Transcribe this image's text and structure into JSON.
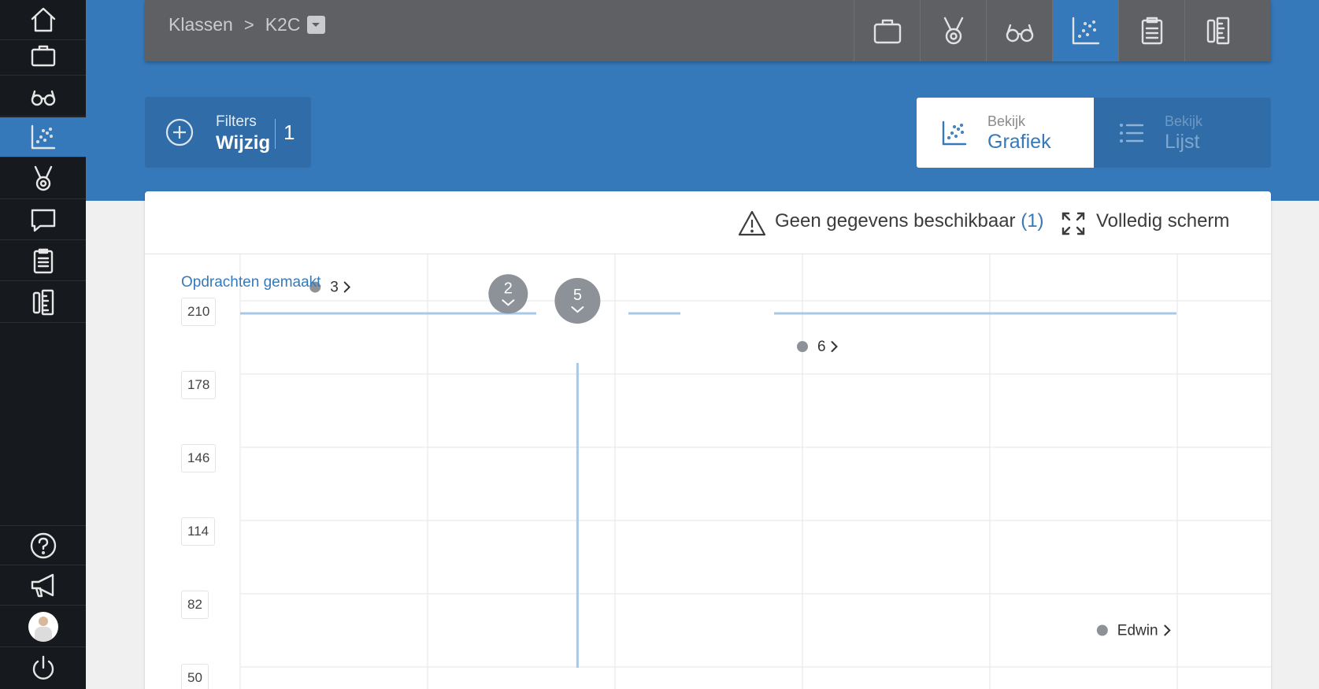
{
  "sidebar": {
    "top_items": [
      {
        "icon": "home-icon"
      },
      {
        "icon": "briefcase-icon"
      },
      {
        "icon": "glasses-icon"
      },
      {
        "icon": "scatter-chart-icon",
        "active": true
      },
      {
        "icon": "medal-icon"
      },
      {
        "icon": "chat-icon"
      },
      {
        "icon": "clipboard-icon"
      },
      {
        "icon": "tools-icon"
      }
    ],
    "bottom_items": [
      {
        "icon": "help-icon"
      },
      {
        "icon": "megaphone-icon"
      },
      {
        "icon": "avatar"
      },
      {
        "icon": "power-icon"
      }
    ]
  },
  "topbar": {
    "breadcrumb": {
      "root": "Klassen",
      "separator": ">",
      "current": "K2C"
    },
    "tools": [
      {
        "icon": "briefcase-icon"
      },
      {
        "icon": "medal-icon"
      },
      {
        "icon": "glasses-icon"
      },
      {
        "icon": "scatter-chart-icon",
        "active": true
      },
      {
        "icon": "clipboard-icon"
      },
      {
        "icon": "tools-icon"
      }
    ]
  },
  "filters": {
    "label": "Filters",
    "action": "Wijzig",
    "count": "1"
  },
  "view_toggle": {
    "grafiek": {
      "small": "Bekijk",
      "big": "Grafiek",
      "active": true
    },
    "lijst": {
      "small": "Bekijk",
      "big": "Lijst",
      "active": false
    }
  },
  "card_header": {
    "warning_text": "Geen gegevens beschikbaar",
    "warning_count": "(1)",
    "fullscreen_label": "Volledig scherm"
  },
  "colors": {
    "accent": "#3579ba",
    "sidebar_bg": "#16191d",
    "topbar_bg": "#5e6064",
    "cluster": "#8d9299",
    "line": "#a9c8e6"
  },
  "chart_data": {
    "type": "scatter",
    "ylabel": "Opdrachten gemaakt",
    "ylim": [
      50,
      220
    ],
    "yticks": [
      210,
      178,
      146,
      114,
      82,
      50
    ],
    "clusters": [
      {
        "label": "3",
        "kind": "point-group",
        "col": 0.4,
        "y": 216
      },
      {
        "label": "2",
        "kind": "bubble",
        "col": 1.43,
        "y": 213
      },
      {
        "label": "5",
        "kind": "bubble",
        "col": 1.8,
        "y": 210
      },
      {
        "label": "6",
        "kind": "point-group",
        "col": 3.0,
        "y": 190
      },
      {
        "label": "Edwin",
        "kind": "point",
        "col": 4.6,
        "y": 66
      }
    ],
    "h_reference": 210,
    "v_reference_col": 1.8
  }
}
